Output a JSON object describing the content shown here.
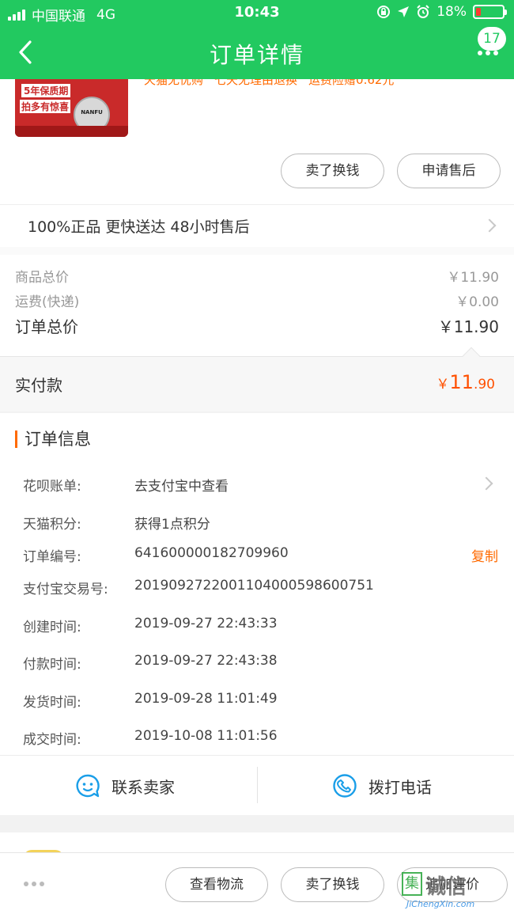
{
  "status_bar": {
    "carrier": "中国联通",
    "network": "4G",
    "time": "10:43",
    "battery": "18%",
    "battery_fraction": 0.18
  },
  "nav": {
    "title": "订单详情",
    "badge_count": "17"
  },
  "product": {
    "image_text_1": "5年保质期",
    "image_text_2": "拍多有惊喜",
    "image_brand": "NANFU",
    "tags": [
      "天猫无忧购",
      "七天无理由退换",
      "运费险赠0.62元"
    ],
    "btn_exchange": "卖了换钱",
    "btn_aftersale": "申请售后"
  },
  "guarantee": "100%正品  更快送达  48小时售后",
  "price": {
    "goods_label": "商品总价",
    "goods_value": "￥11.90",
    "shipping_label": "运费(快递)",
    "shipping_value": "￥0.00",
    "total_label": "订单总价",
    "total_value": "￥11.90",
    "paid_label": "实付款",
    "paid_symbol": "￥",
    "paid_int": "11",
    "paid_dec": ".90"
  },
  "order_info": {
    "title": "订单信息",
    "rows": [
      {
        "key": "花呗账单:",
        "value": "去支付宝中查看"
      },
      {
        "key": "天猫积分:",
        "value": "获得1点积分"
      },
      {
        "key": "订单编号:",
        "value": "641600000182709960"
      },
      {
        "key": "支付宝交易号:",
        "value": "2019092722001104000598600751"
      },
      {
        "key": "创建时间:",
        "value": "2019-09-27 22:43:33"
      },
      {
        "key": "付款时间:",
        "value": "2019-09-27 22:43:38"
      },
      {
        "key": "发货时间:",
        "value": "2019-09-28 11:01:49"
      },
      {
        "key": "成交时间:",
        "value": "2019-10-08 11:01:56"
      }
    ],
    "copy_label": "复制",
    "contact_seller": "联系卖家",
    "call_phone": "拨打电话"
  },
  "bottom_bar": {
    "view_logistics": "查看物流",
    "exchange": "卖了换钱",
    "review": "追加评价"
  },
  "watermark": {
    "logo_char": "集",
    "text": "诚信",
    "url": "JiChengXin.com"
  },
  "colors": {
    "brand_green": "#22c960",
    "accent_orange": "#ff5000",
    "icon_blue": "#1a9ee8"
  }
}
